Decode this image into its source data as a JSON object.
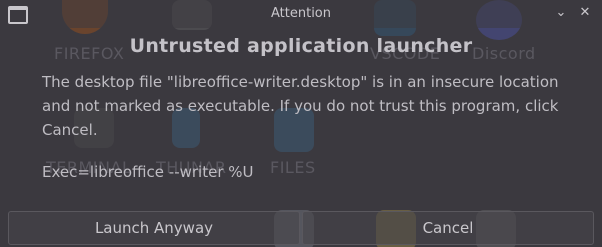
{
  "window": {
    "title": "Attention",
    "minimize_glyph": "⌄",
    "close_glyph": "✕"
  },
  "dialog": {
    "heading": "Untrusted application launcher",
    "message": "The desktop file \"libreoffice-writer.desktop\" is in an insecure location and not marked as executable. If you do not trust this program, click Cancel.",
    "exec_line": "Exec=libreoffice --writer %U"
  },
  "buttons": {
    "launch_label": "Launch Anyway",
    "cancel_label": "Cancel"
  },
  "background_desktop": {
    "labels": [
      "FIREFOX",
      "VSCODE",
      "Discord",
      "TERMINAL",
      "THUNAR",
      "FILES"
    ]
  },
  "colors": {
    "dialog_bg": "#3b393f",
    "text": "#bfbdc3",
    "firefox": "#e66000",
    "discord": "#5865f2",
    "vscode": "#2c6fa0"
  }
}
